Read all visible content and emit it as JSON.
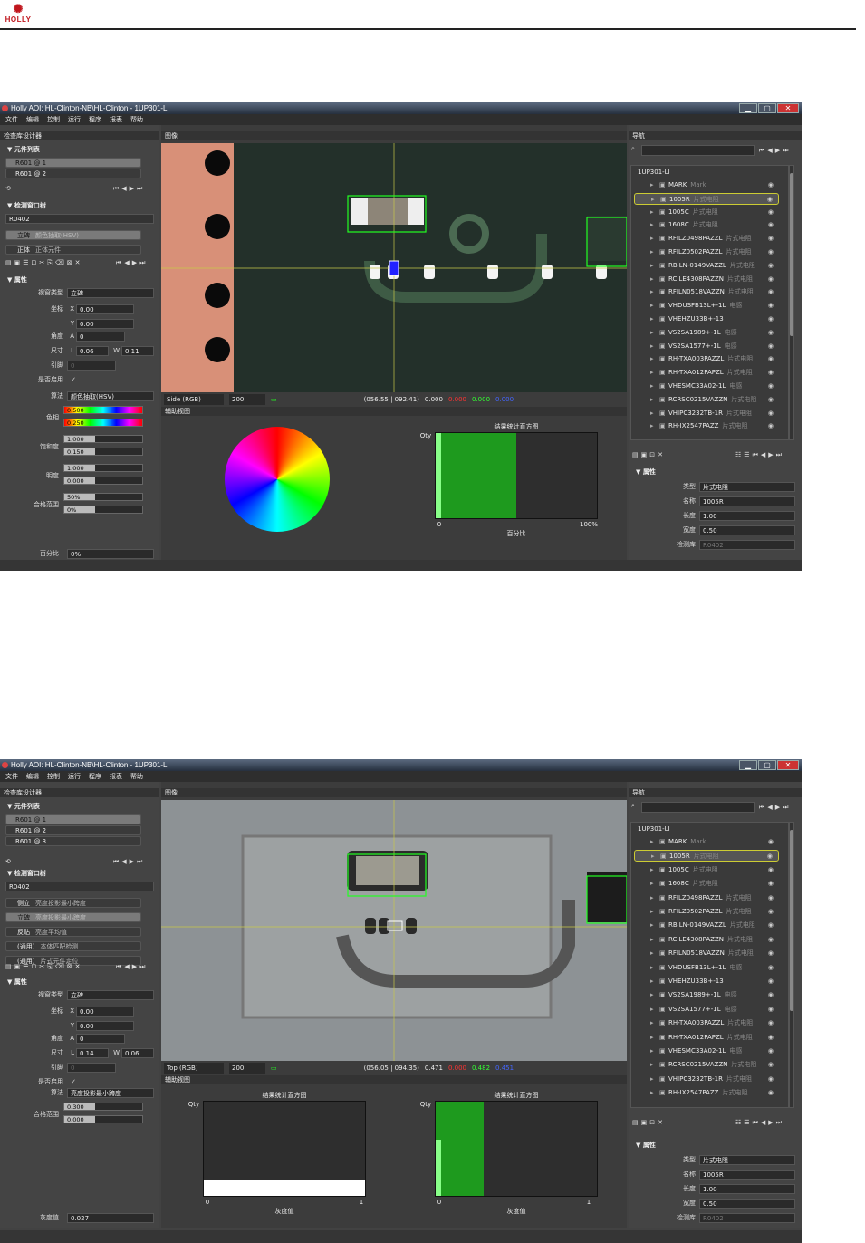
{
  "logo": {
    "text": "HOLLY"
  },
  "screens": [
    {
      "title": "Holly AOI: HL-Clinton-NB\\HL-Clinton - 1UP301-LI",
      "menu": [
        "文件",
        "编辑",
        "控制",
        "运行",
        "程序",
        "报表",
        "帮助"
      ],
      "left": {
        "designer": "检查库设计器",
        "parts_header": "▼ 元件列表",
        "parts": [
          "R601 @ 1",
          "R601 @ 2"
        ],
        "window_header": "▼ 检测窗口树",
        "window_name": "R0402",
        "windows": [
          {
            "a": "立碑",
            "b": "颜色抽取(HSV)"
          },
          {
            "a": "正体",
            "b": "正体元件"
          }
        ],
        "props_header": "▼ 属性",
        "props": {
          "type_label": "视窗类型",
          "type_value": "立碑",
          "coord_label": "坐标",
          "x": "0.00",
          "y": "0.00",
          "angle_label": "角度",
          "a": "0",
          "size_label": "尺寸",
          "l": "0.06",
          "w": "0.11",
          "pin_label": "引脚",
          "pin": "0",
          "enable_label": "是否启用",
          "enable": "✓"
        },
        "algo_label": "算法",
        "algo_value": "颜色抽取(HSV)",
        "hsv": [
          {
            "label": "色相",
            "v1": "0.500",
            "v2": "0.250"
          },
          {
            "label": "饱和度",
            "v1": "1.000",
            "v2": "0.150"
          },
          {
            "label": "明度",
            "v1": "1.000",
            "v2": "0.000"
          },
          {
            "label": "合格范围",
            "v1": "50%",
            "v2": "0%"
          }
        ],
        "ratio_label": "百分比",
        "ratio": "0%"
      },
      "image": {
        "header": "图像",
        "mode": "Side (RGB)",
        "zoom": "200",
        "coords": "(056.55 | 092.41)",
        "v0": "0.000",
        "v1": "0.000",
        "v2": "0.000",
        "v3": "0.000",
        "aux_header": "辅助视图",
        "hist_title": "结果统计直方图",
        "qty": "Qty",
        "x0": "0",
        "x1": "100%",
        "xlabel": "百分比",
        "hist_fill": 0.5
      },
      "nav": {
        "header": "导航",
        "root": "1UP301-LI",
        "items": [
          {
            "n": "MARK",
            "s": "Mark"
          },
          {
            "n": "1005R",
            "s": "片式电阻"
          },
          {
            "n": "1005C",
            "s": "片式电阻"
          },
          {
            "n": "1608C",
            "s": "片式电阻"
          },
          {
            "n": "RFILZ0498PAZZL",
            "s": "片式电阻"
          },
          {
            "n": "RFILZ0502PAZZL",
            "s": "片式电阻"
          },
          {
            "n": "RBILN-0149VAZZL",
            "s": "片式电阻"
          },
          {
            "n": "RCILE4308PAZZN",
            "s": "片式电阻"
          },
          {
            "n": "RFILN0518VAZZN",
            "s": "片式电阻"
          },
          {
            "n": "VHDUSFB13L+-1L",
            "s": "电感"
          },
          {
            "n": "VHEHZU33B+-13",
            "s": ""
          },
          {
            "n": "VS2SA1989+-1L",
            "s": "电感"
          },
          {
            "n": "VS2SA1577+-1L",
            "s": "电感"
          },
          {
            "n": "RH-TXA003PAZZL",
            "s": "片式电阻"
          },
          {
            "n": "RH-TXA012PAPZL",
            "s": "片式电阻"
          },
          {
            "n": "VHESMC33A02-1L",
            "s": "电感"
          },
          {
            "n": "RCRSC0215VAZZN",
            "s": "片式电阻"
          },
          {
            "n": "VHIPC3232TB-1R",
            "s": "片式电阻"
          },
          {
            "n": "RH-IX2547PAZZ",
            "s": "片式电阻"
          }
        ],
        "props_header": "▼ 属性",
        "props": [
          {
            "k": "类型",
            "v": "片式电阻"
          },
          {
            "k": "名称",
            "v": "1005R"
          },
          {
            "k": "长度",
            "v": "1.00"
          },
          {
            "k": "宽度",
            "v": "0.50"
          },
          {
            "k": "检测库",
            "v": "R0402"
          }
        ]
      }
    },
    {
      "title": "Holly AOI: HL-Clinton-NB\\HL-Clinton - 1UP301-LI",
      "menu": [
        "文件",
        "编辑",
        "控制",
        "运行",
        "程序",
        "报表",
        "帮助"
      ],
      "left": {
        "designer": "检查库设计器",
        "parts_header": "▼ 元件列表",
        "parts": [
          "R601 @ 1",
          "R601 @ 2",
          "R601 @ 3"
        ],
        "window_header": "▼ 检测窗口树",
        "window_name": "R0402",
        "windows": [
          {
            "a": "侧立",
            "b": "亮度投影最小跨度"
          },
          {
            "a": "立碑",
            "b": "亮度投影最小跨度"
          },
          {
            "a": "反贴",
            "b": "亮度平均值"
          },
          {
            "a": "(通用)",
            "b": "本体匹配检测"
          },
          {
            "a": "(通用)",
            "b": "片式元件定位"
          }
        ],
        "props_header": "▼ 属性",
        "props": {
          "type_label": "视窗类型",
          "type_value": "立碑",
          "coord_label": "坐标",
          "x": "0.00",
          "y": "0.00",
          "angle_label": "角度",
          "a": "0",
          "size_label": "尺寸",
          "l": "0.14",
          "w": "0.06",
          "pin_label": "引脚",
          "pin": "0",
          "enable_label": "是否启用",
          "enable": "✓"
        },
        "algo_label": "算法",
        "algo_value": "亮度投影最小跨度",
        "hsv": [
          {
            "label": "合格范围",
            "v1": "0.300",
            "v2": "0.000"
          }
        ],
        "ratio_label": "灰度值",
        "ratio": "0.027"
      },
      "image": {
        "header": "图像",
        "mode": "Top (RGB)",
        "zoom": "200",
        "coords": "(056.05 | 094.35)",
        "v0": "0.471",
        "v1": "0.000",
        "v2": "0.482",
        "v3": "0.451",
        "aux_header": "辅助视图",
        "hist_title": "结果统计直方图",
        "qty": "Qty",
        "x0": "0",
        "x1": "1",
        "xlabel": "灰度值",
        "hist_fill": 0.3
      },
      "nav": {
        "header": "导航",
        "root": "1UP301-LI",
        "items": [
          {
            "n": "MARK",
            "s": "Mark"
          },
          {
            "n": "1005R",
            "s": "片式电阻"
          },
          {
            "n": "1005C",
            "s": "片式电阻"
          },
          {
            "n": "1608C",
            "s": "片式电阻"
          },
          {
            "n": "RFILZ0498PAZZL",
            "s": "片式电阻"
          },
          {
            "n": "RFILZ0502PAZZL",
            "s": "片式电阻"
          },
          {
            "n": "RBILN-0149VAZZL",
            "s": "片式电阻"
          },
          {
            "n": "RCILE4308PAZZN",
            "s": "片式电阻"
          },
          {
            "n": "RFILN0518VAZZN",
            "s": "片式电阻"
          },
          {
            "n": "VHDUSFB13L+-1L",
            "s": "电感"
          },
          {
            "n": "VHEHZU33B+-13",
            "s": ""
          },
          {
            "n": "VS2SA1989+-1L",
            "s": "电感"
          },
          {
            "n": "VS2SA1577+-1L",
            "s": "电感"
          },
          {
            "n": "RH-TXA003PAZZL",
            "s": "片式电阻"
          },
          {
            "n": "RH-TXA012PAPZL",
            "s": "片式电阻"
          },
          {
            "n": "VHESMC33A02-1L",
            "s": "电感"
          },
          {
            "n": "RCRSC0215VAZZN",
            "s": "片式电阻"
          },
          {
            "n": "VHIPC3232TB-1R",
            "s": "片式电阻"
          },
          {
            "n": "RH-IX2547PAZZ",
            "s": "片式电阻"
          }
        ],
        "props_header": "▼ 属性",
        "props": [
          {
            "k": "类型",
            "v": "片式电阻"
          },
          {
            "k": "名称",
            "v": "1005R"
          },
          {
            "k": "长度",
            "v": "1.00"
          },
          {
            "k": "宽度",
            "v": "0.50"
          },
          {
            "k": "检测库",
            "v": "R0402"
          }
        ]
      }
    }
  ]
}
